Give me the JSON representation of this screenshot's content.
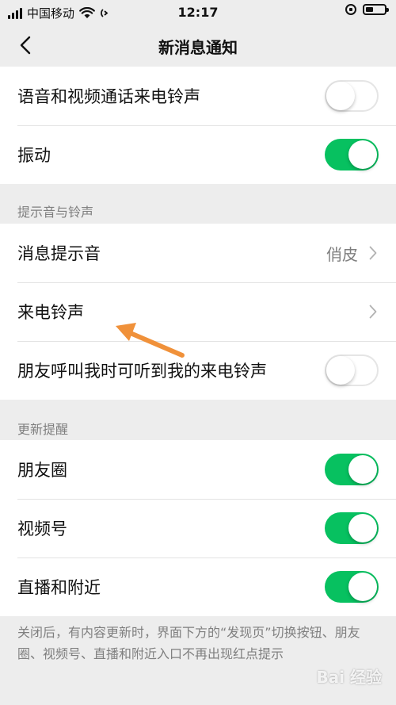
{
  "status_bar": {
    "carrier": "中国移动",
    "time": "12:17"
  },
  "nav": {
    "title": "新消息通知"
  },
  "group1": {
    "items": [
      {
        "label": "语音和视频通话来电铃声",
        "toggle": "off"
      },
      {
        "label": "振动",
        "toggle": "on"
      }
    ]
  },
  "section_sounds": {
    "header": "提示音与铃声",
    "items": [
      {
        "label": "消息提示音",
        "value": "俏皮"
      },
      {
        "label": "来电铃声"
      },
      {
        "label": "朋友呼叫我时可听到我的来电铃声",
        "toggle": "off"
      }
    ]
  },
  "section_updates": {
    "header": "更新提醒",
    "items": [
      {
        "label": "朋友圈",
        "toggle": "on"
      },
      {
        "label": "视频号",
        "toggle": "on"
      },
      {
        "label": "直播和附近",
        "toggle": "on"
      }
    ],
    "footer": "关闭后，有内容更新时，界面下方的“发现页”切换按钮、朋友圈、视频号、直播和附近入口不再出现红点提示"
  },
  "watermark": {
    "text": "Bai 经验"
  },
  "colors": {
    "accent_green": "#07c160",
    "background": "#ededed",
    "annotation_arrow": "#f0913a"
  },
  "icons": {
    "back": "chevron-left-icon",
    "row_chevron": "chevron-right-icon",
    "wifi": "wifi-icon",
    "battery": "battery-icon"
  }
}
